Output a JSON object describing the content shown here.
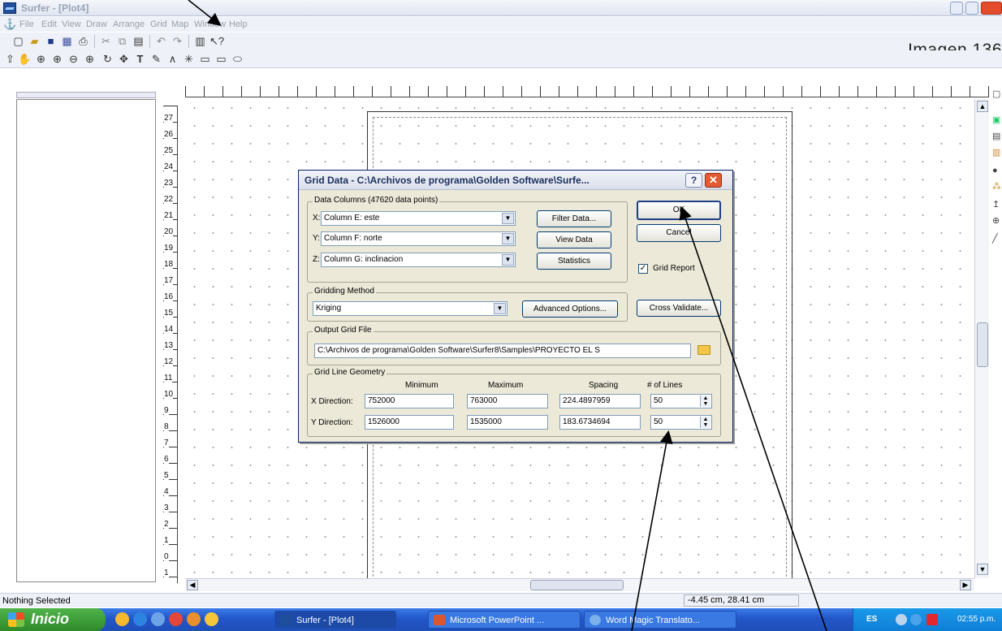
{
  "window": {
    "title": "Surfer - [Plot4]"
  },
  "menu": [
    "File",
    "Edit",
    "View",
    "Draw",
    "Arrange",
    "Grid",
    "Map",
    "Window",
    "Help"
  ],
  "caption": "Imagen 136",
  "ruler_left_labels": [
    "27",
    "26",
    "25",
    "24",
    "23",
    "22",
    "21",
    "20",
    "19",
    "18",
    "17",
    "16",
    "15",
    "14",
    "13",
    "12",
    "11",
    "10",
    "9",
    "8",
    "7",
    "6",
    "5",
    "4",
    "3",
    "2",
    "1",
    "0",
    "1"
  ],
  "dialog": {
    "title": "Grid Data - C:\\Archivos de programa\\Golden Software\\Surfe...",
    "help_label": "?",
    "close_label": "✕",
    "data_columns": {
      "label": "Data Columns   (47620 data points)",
      "x_label": "X:",
      "x_value": "Column E:  este",
      "y_label": "Y:",
      "y_value": "Column F:  norte",
      "z_label": "Z:",
      "z_value": "Column G:  inclinacion"
    },
    "filter_data": "Filter Data...",
    "view_data": "View Data",
    "statistics": "Statistics",
    "ok": "OK",
    "cancel": "Cancel",
    "grid_report": "Grid Report",
    "gridding_method": {
      "label": "Gridding Method",
      "value": "Kriging"
    },
    "advanced_options": "Advanced Options...",
    "cross_validate": "Cross Validate...",
    "output_grid_file": {
      "label": "Output Grid File",
      "value": "C:\\Archivos de programa\\Golden Software\\Surfer8\\Samples\\PROYECTO EL S"
    },
    "geometry": {
      "label": "Grid Line Geometry",
      "col_minimum": "Minimum",
      "col_maximum": "Maximum",
      "col_spacing": "Spacing",
      "col_lines": "# of Lines",
      "x_label": "X Direction:",
      "y_label": "Y Direction:",
      "x": {
        "min": "752000",
        "max": "763000",
        "spacing": "224.4897959",
        "lines": "50"
      },
      "y": {
        "min": "1526000",
        "max": "1535000",
        "spacing": "183.6734694",
        "lines": "50"
      }
    }
  },
  "status": {
    "selection": "Nothing Selected",
    "coords": "-4.45 cm, 28.41 cm"
  },
  "taskbar": {
    "start": "Inicio",
    "tasks": [
      "Surfer - [Plot4]",
      "Microsoft PowerPoint ...",
      "Word Magic Translato..."
    ],
    "lang": "ES",
    "time": "02:55 p.m."
  }
}
